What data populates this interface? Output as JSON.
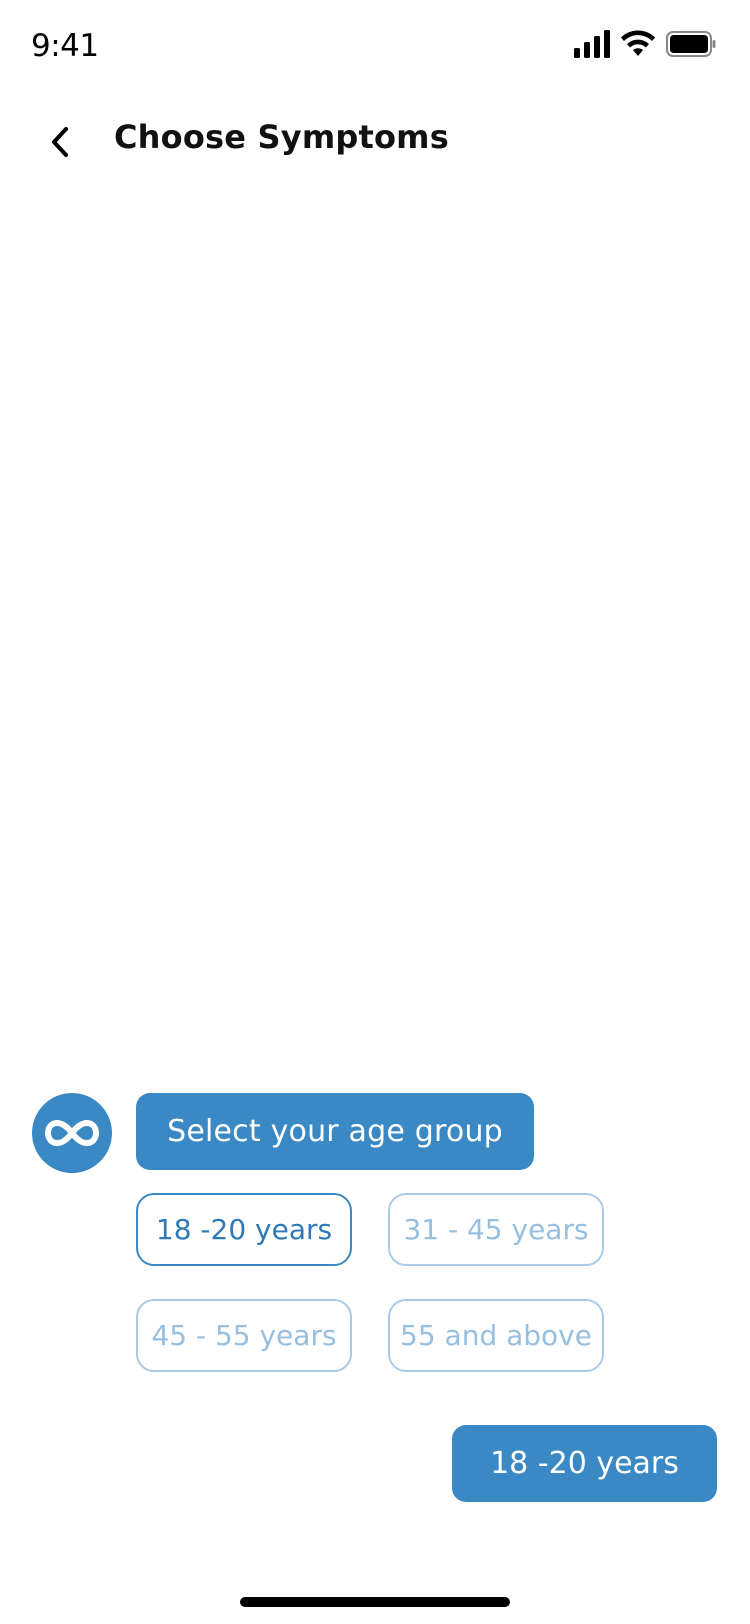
{
  "status_bar": {
    "time": "9:41",
    "icons": [
      "cellular-signal-icon",
      "wifi-icon",
      "battery-icon"
    ]
  },
  "header": {
    "back_icon": "chevron-left-icon",
    "title": "Choose Symptoms"
  },
  "chat": {
    "bot_avatar_icon": "infinity-icon",
    "bot_message": "Select your age group",
    "options": [
      {
        "label": "18 -20 years",
        "selected": true
      },
      {
        "label": "31 - 45 years",
        "selected": false
      },
      {
        "label": "45 - 55 years",
        "selected": false
      },
      {
        "label": "55 and above",
        "selected": false
      }
    ],
    "user_reply": "18 -20 years"
  },
  "colors": {
    "accent": "#3a89c4",
    "option_inactive_border": "#a9cbe7",
    "option_inactive_text": "#97bfe0"
  }
}
